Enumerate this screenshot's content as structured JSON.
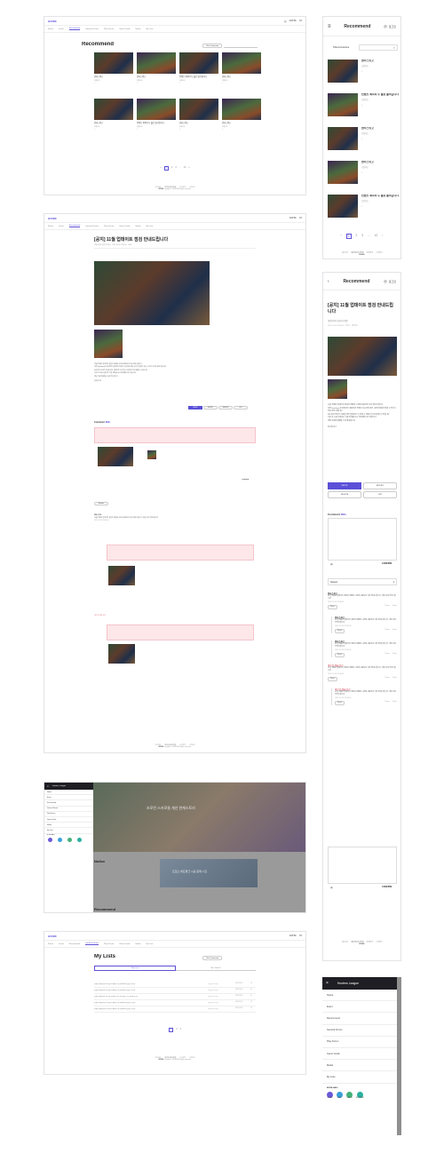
{
  "brand": {
    "logo": "HUNNI",
    "colors": {
      "accent": "#5b4fd8",
      "pink": "#fde7e9",
      "overlay": "#9a9a9a"
    }
  },
  "nav": {
    "items": [
      "Notice",
      "Event",
      "Recommend",
      "General Forum",
      "Play Forum",
      "Game Guide",
      "Media",
      "My Lists"
    ]
  },
  "header": {
    "user": "RAFTik",
    "lang": "KO",
    "lang_icon": "globe-icon"
  },
  "recommend": {
    "title": "Recommend",
    "filter": "Title+Contents",
    "mobile_lang": "로그인"
  },
  "cards": [
    {
      "title": "현타스의고",
      "sub": "포털자도",
      "meta": "3",
      "extra": ""
    },
    {
      "title": "현타스의고",
      "sub": "포털자도",
      "meta": "3",
      "extra": ""
    },
    {
      "title": "컨텐츠 제목이 두 줄로 들어갑니다",
      "sub": "포털자도",
      "meta": "3",
      "extra": ""
    },
    {
      "title": "현타스의고",
      "sub": "포털자도",
      "meta": "3",
      "extra": ""
    },
    {
      "title": "현타스의고",
      "sub": "포털자도",
      "meta": "3",
      "extra": ""
    },
    {
      "title": "컨텐츠 제목이 두 줄로 들어갑니다",
      "sub": "포털자도",
      "meta": "3",
      "extra": ""
    },
    {
      "title": "현타스의고",
      "sub": "포털자도",
      "meta": "3",
      "extra": ""
    },
    {
      "title": "현타스의고",
      "sub": "포털자도",
      "meta": "3",
      "extra": ""
    }
  ],
  "mobile_list": [
    {
      "title": "현타스의고",
      "sub": "포털자도",
      "meta": "3"
    },
    {
      "title": "컨텐츠 제목이 두 줄로 들어갑니다",
      "sub": "포털자도",
      "meta": "3"
    },
    {
      "title": "현타스의고",
      "sub": "포털자도",
      "meta": "3"
    },
    {
      "title": "현타스의고",
      "sub": "포털자도",
      "meta": "3"
    },
    {
      "title": "컨텐츠 제목이 두 줄로 들어갑니다",
      "sub": "포털자도",
      "meta": "3"
    }
  ],
  "pagination": {
    "pages": [
      "1",
      "2",
      "3",
      "...",
      "10"
    ],
    "prev": "‹",
    "next": "›",
    "first": "«",
    "last": "»"
  },
  "footer": {
    "links": [
      "이용약관",
      "개인정보처리방침",
      "운영정책",
      "고객센터"
    ],
    "brand": "BORA",
    "copy": "Copyright © BORA. All rights reserved."
  },
  "post": {
    "title": "[공지] 11월 업데이트 점검 안내드립니다",
    "author": "게임운영자 담당자닉네임",
    "date": "2019.10.24 23:38:00",
    "views": "조회 1",
    "likes": "좋아요 1",
    "body": [
      "11월 전체한 업데이트 점검이 예정된 시간에 완료되어 지금 안내드립니다",
      "다만 SunGrace한 업데이트 점검이란 진행이 가능하며 여러 시간의 점검이 있을 수 있으니 미리 확인 바랍니다",
      "원스토어 유저가 이용할 경우 업데이트 후 진행 시 데이터가 초기화될 수 있습니다",
      "기존 만 11세 사용자는 이용 안내를 다시 확인해주시기 바랍니다",
      "게임 이용에 불편을 드려 죄송합니다"
    ],
    "sign": "감사합니다",
    "buttons": [
      "WRITE",
      "MODIFY",
      "DELETE",
      "LIST"
    ]
  },
  "comments": {
    "label": "Comment",
    "count": "999+",
    "placeholder": "",
    "submit": "CONFIRM",
    "sort": "Newest",
    "reply_hint": "내가 쓴 댓글 보기",
    "reply": "Reply",
    "report": "Report",
    "delete": "Delete",
    "items": [
      {
        "name": "현타스의고",
        "text": "11월 전체한 업데이트 점검이 예정된 시간에 완료되어 지금 안내드립니다. 게임 이용 부탁드립니다",
        "date": "2019.10.24 23:38:00"
      },
      {
        "name": "현타스의고",
        "text": "11월 전체한 업데이트 점검이 예정된 시간에 완료되어 지금 안내드립니다. 게임 이용 부탁드립니다",
        "date": "2019.10.24 23:38:00"
      },
      {
        "name": "현타스의고",
        "text": "11월 전체한 업데이트 점검이 예정된 시간에 완료되어 지금 안내드립니다. 게임 이용 부탁드립니다",
        "date": "2019.10.24 23:38:00"
      },
      {
        "name": "내가 쓴 댓글 보기",
        "text": "11월 전체한 업데이트 점검이 예정된 시간에 완료되어 지금 안내드립니다. 게임 이용 부탁드립니다",
        "date": "2019.10.24 23:38:00"
      },
      {
        "name": "내가 쓴 댓글 보기",
        "text": "11월 전체한 업데이트 점검이 예정된 시간에 완료되어 지금 안내드립니다. 게임 이용 부탁드립니다",
        "date": "2019.10.24 23:38:00"
      }
    ]
  },
  "drawer": {
    "title": "Hunters League",
    "close": "×",
    "items": [
      "Notice",
      "Event",
      "Recommend",
      "General Forum",
      "Play Forum",
      "Game Guide",
      "Media",
      "My Lists"
    ],
    "bora_label": "BORA HALL",
    "apps": [
      {
        "name": "ISLAND",
        "color": "#6a5ad8"
      },
      {
        "name": "ATELL",
        "color": "#3aa0d8"
      },
      {
        "name": "LUCION",
        "color": "#45b27a"
      },
      {
        "name": "EXPLORER",
        "color": "#2bb0a0"
      }
    ]
  },
  "home": {
    "hero_text": "조로린 스카로들 개선 연계스토리",
    "notice": "Notice",
    "recommend": "Recommend",
    "banner_text": "프로스 네트워크 시공 문제 시간"
  },
  "mylists": {
    "title": "My Lists",
    "tabs": [
      "Write Post",
      "My Comment"
    ],
    "filter": "Title+Contents",
    "rows": [
      {
        "title": "[이벤트] 11월 업데이트 점검이 예정된 시간에 완료되어 점검합니다 (2)",
        "author": "게임운영자닉네임",
        "date": "2019.10.24",
        "views": "13"
      },
      {
        "title": "[이벤트] 11월 업데이트 점검이 예정된 시간에 완료되어 점검합니다 (2)",
        "author": "게임운영자닉네임",
        "date": "2019.10.24",
        "views": "13"
      },
      {
        "title": "[이벤트] 11월 업데이트 점검 안내드립니다 이번 점검은 시간 조율 중입니다",
        "author": "게임운영자닉네임",
        "date": "2019.10.24",
        "views": "13"
      },
      {
        "title": "[이벤트] 11월 업데이트 점검이 예정된 시간에 완료되어 점검합니다 (2)",
        "author": "게임운영자닉네임",
        "date": "2019.10.24",
        "views": "13"
      },
      {
        "title": "[이벤트] 11월 업데이트 점검이 예정된 시간에 완료되어 점검합니다 (2)",
        "author": "게임운영자닉네임",
        "date": "2019.10.24",
        "views": "13"
      }
    ]
  }
}
